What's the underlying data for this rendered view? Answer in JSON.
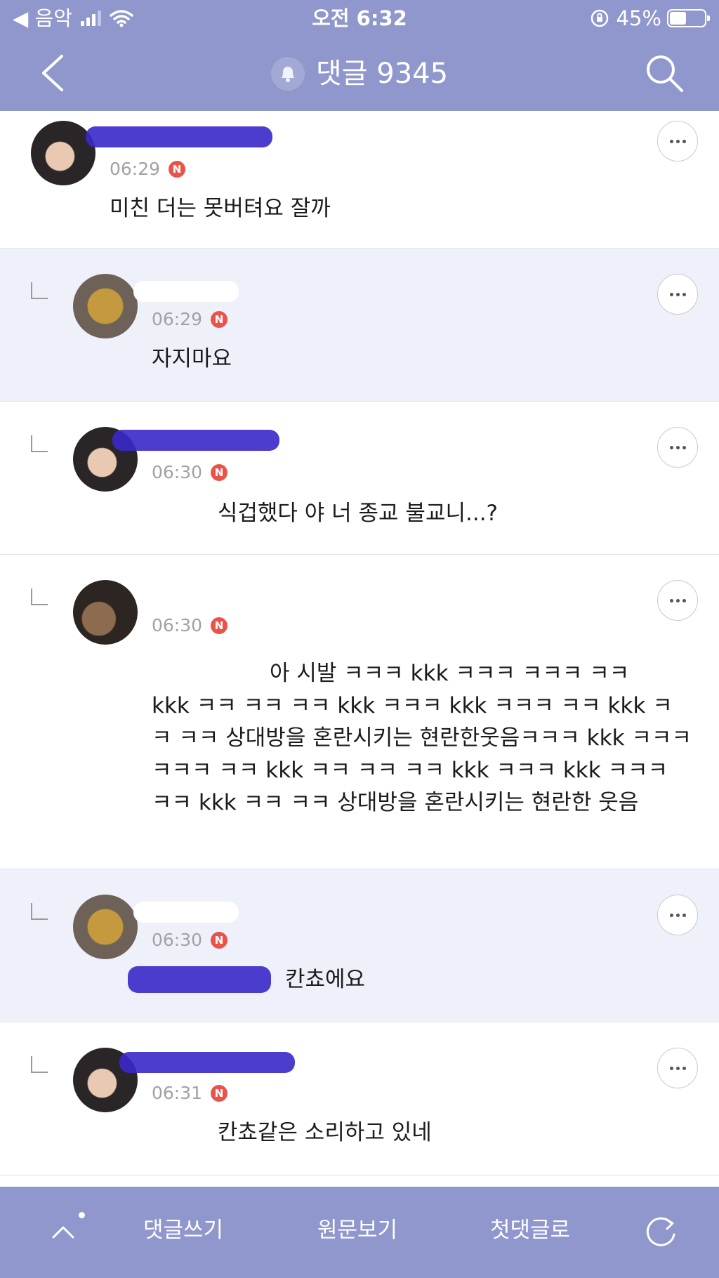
{
  "status_bar": {
    "back_app": "◀ 음악",
    "time": "오전 6:32",
    "battery": "45%"
  },
  "nav": {
    "title": "댓글 9345"
  },
  "comments": [
    {
      "time": "06:29",
      "badge": "N",
      "text": "미친 더는 못버텨요 잘까"
    },
    {
      "time": "06:29",
      "badge": "N",
      "text": "자지마요"
    },
    {
      "time": "06:30",
      "badge": "N",
      "text": "식겁했다 야 너 종교 불교니...?"
    },
    {
      "time": "06:30",
      "badge": "N",
      "text_line1": "아 시발 ㅋㅋㅋ kkk ㅋㅋㅋ ㅋㅋㅋ ㅋㅋ",
      "text_rest": "kkk ㅋㅋ ㅋㅋ ㅋㅋ kkk ㅋㅋㅋ kkk ㅋㅋㅋ ㅋㅋ kkk ㅋㅋ ㅋㅋ 상대방을 혼란시키는 현란한웃음ㅋㅋㅋ kkk ㅋㅋㅋ ㅋㅋㅋ ㅋㅋ kkk ㅋㅋ ㅋㅋ ㅋㅋ kkk ㅋㅋㅋ kkk ㅋㅋㅋ ㅋㅋ kkk ㅋㅋ ㅋㅋ 상대방을 혼란시키는 현란한 웃음"
    },
    {
      "time": "06:30",
      "badge": "N",
      "text": "칸쵸에요"
    },
    {
      "time": "06:31",
      "badge": "N",
      "text": "칸쵸같은 소리하고 있네"
    }
  ],
  "bottom_bar": {
    "write": "댓글쓰기",
    "original": "원문보기",
    "first": "첫댓글로"
  },
  "colors": {
    "bar": "#8f97cc",
    "highlight_row": "#eef1fa",
    "badge": "#e9534a",
    "scribble": "#3a28c9"
  }
}
